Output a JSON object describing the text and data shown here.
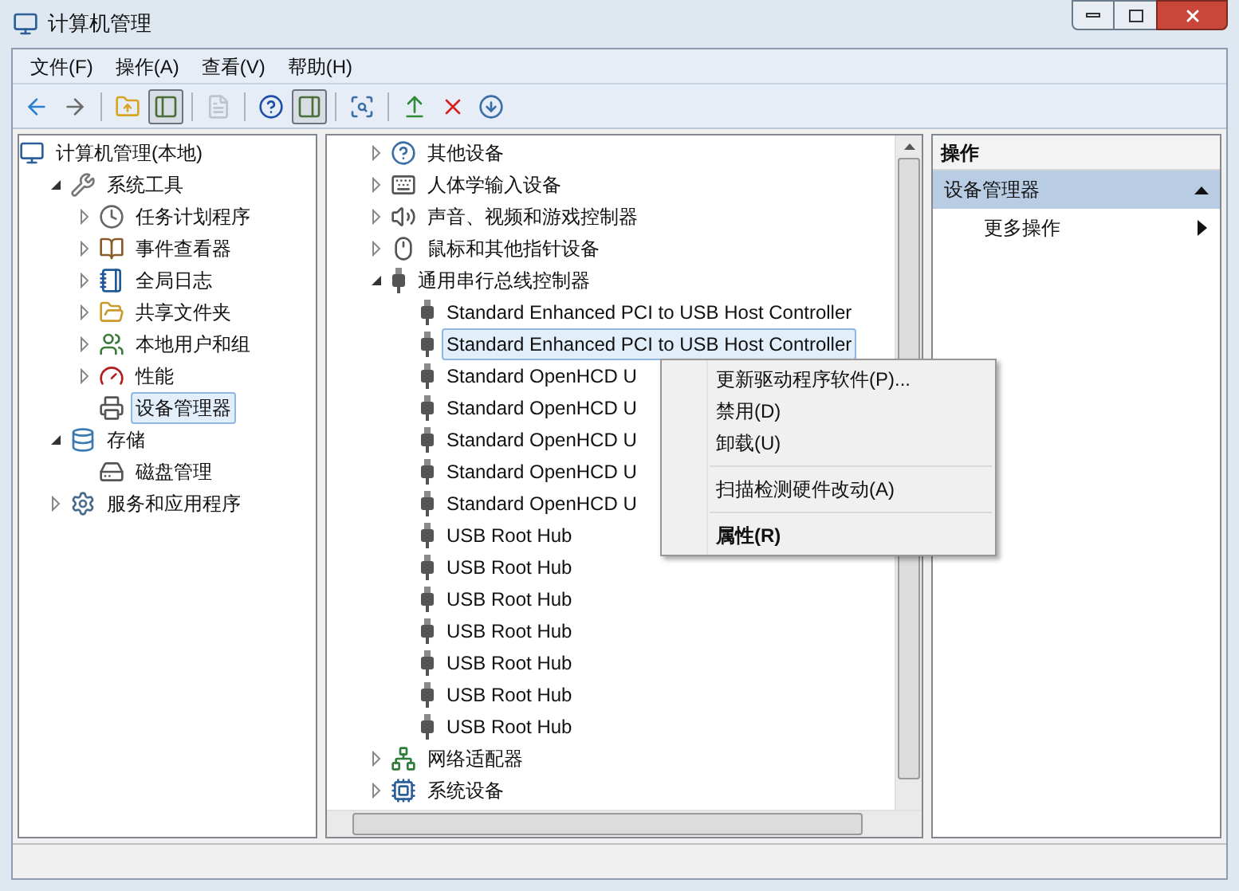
{
  "window": {
    "title": "计算机管理"
  },
  "menu_bar": [
    {
      "label": "文件(F)"
    },
    {
      "label": "操作(A)"
    },
    {
      "label": "查看(V)"
    },
    {
      "label": "帮助(H)"
    }
  ],
  "toolbar": [
    {
      "kind": "button",
      "pressed": false,
      "disabled": false
    },
    {
      "kind": "button",
      "pressed": false,
      "disabled": false
    },
    {
      "kind": "separator"
    },
    {
      "kind": "button",
      "pressed": false,
      "disabled": false
    },
    {
      "kind": "button",
      "pressed": true,
      "disabled": false
    },
    {
      "kind": "separator"
    },
    {
      "kind": "button",
      "pressed": false,
      "disabled": true
    },
    {
      "kind": "separator"
    },
    {
      "kind": "button",
      "pressed": false,
      "disabled": false
    },
    {
      "kind": "button",
      "pressed": true,
      "disabled": false
    },
    {
      "kind": "separator"
    },
    {
      "kind": "button",
      "pressed": false,
      "disabled": false
    },
    {
      "kind": "separator"
    },
    {
      "kind": "button",
      "pressed": false,
      "disabled": false
    },
    {
      "kind": "button",
      "pressed": false,
      "disabled": false
    },
    {
      "kind": "button",
      "pressed": false,
      "disabled": false
    }
  ],
  "console_tree": [
    {
      "kind": "root",
      "label": "计算机管理(本地)",
      "selected": false,
      "children": [
        {
          "kind": "branch",
          "label": "系统工具",
          "expanded": true,
          "selected": false,
          "children": [
            {
              "kind": "branch",
              "label": "任务计划程序",
              "expanded": false,
              "selected": false
            },
            {
              "kind": "branch",
              "label": "事件查看器",
              "expanded": false,
              "selected": false
            },
            {
              "kind": "branch",
              "label": "全局日志",
              "expanded": false,
              "selected": false
            },
            {
              "kind": "branch",
              "label": "共享文件夹",
              "expanded": false,
              "selected": false
            },
            {
              "kind": "branch",
              "label": "本地用户和组",
              "expanded": false,
              "selected": false
            },
            {
              "kind": "branch",
              "label": "性能",
              "expanded": false,
              "selected": false
            },
            {
              "kind": "leaf",
              "label": "设备管理器",
              "selected": true
            }
          ]
        },
        {
          "kind": "branch",
          "label": "存储",
          "expanded": true,
          "selected": false,
          "children": [
            {
              "kind": "leaf",
              "label": "磁盘管理",
              "selected": false
            }
          ]
        },
        {
          "kind": "branch",
          "label": "服务和应用程序",
          "expanded": false,
          "selected": false
        }
      ]
    }
  ],
  "device_tree": [
    {
      "kind": "branch",
      "label": "其他设备",
      "expanded": false,
      "selected": false
    },
    {
      "kind": "branch",
      "label": "人体学输入设备",
      "expanded": false,
      "selected": false
    },
    {
      "kind": "branch",
      "label": "声音、视频和游戏控制器",
      "expanded": false,
      "selected": false
    },
    {
      "kind": "branch",
      "label": "鼠标和其他指针设备",
      "expanded": false,
      "selected": false
    },
    {
      "kind": "branch",
      "label": "通用串行总线控制器",
      "expanded": true,
      "selected": false,
      "children": [
        {
          "kind": "leaf",
          "label": "Standard Enhanced PCI to USB Host Controller",
          "selected": false
        },
        {
          "kind": "leaf",
          "label": "Standard Enhanced PCI to USB Host Controller",
          "selected": true
        },
        {
          "kind": "leaf",
          "label": "Standard OpenHCD U",
          "selected": false
        },
        {
          "kind": "leaf",
          "label": "Standard OpenHCD U",
          "selected": false
        },
        {
          "kind": "leaf",
          "label": "Standard OpenHCD U",
          "selected": false
        },
        {
          "kind": "leaf",
          "label": "Standard OpenHCD U",
          "selected": false
        },
        {
          "kind": "leaf",
          "label": "Standard OpenHCD U",
          "selected": false
        },
        {
          "kind": "leaf",
          "label": "USB Root Hub",
          "selected": false
        },
        {
          "kind": "leaf",
          "label": "USB Root Hub",
          "selected": false
        },
        {
          "kind": "leaf",
          "label": "USB Root Hub",
          "selected": false
        },
        {
          "kind": "leaf",
          "label": "USB Root Hub",
          "selected": false
        },
        {
          "kind": "leaf",
          "label": "USB Root Hub",
          "selected": false
        },
        {
          "kind": "leaf",
          "label": "USB Root Hub",
          "selected": false
        },
        {
          "kind": "leaf",
          "label": "USB Root Hub",
          "selected": false
        }
      ]
    },
    {
      "kind": "branch",
      "label": "网络适配器",
      "expanded": false,
      "selected": false
    },
    {
      "kind": "branch",
      "label": "系统设备",
      "expanded": false,
      "selected": false
    }
  ],
  "context_menu": [
    {
      "kind": "item",
      "label": "更新驱动程序软件(P)...",
      "default": false
    },
    {
      "kind": "item",
      "label": "禁用(D)",
      "default": false
    },
    {
      "kind": "item",
      "label": "卸载(U)",
      "default": false
    },
    {
      "kind": "separator"
    },
    {
      "kind": "item",
      "label": "扫描检测硬件改动(A)",
      "default": false
    },
    {
      "kind": "separator"
    },
    {
      "kind": "item",
      "label": "属性(R)",
      "default": true
    }
  ],
  "actions_pane": {
    "title": "操作",
    "sections": [
      {
        "label": "设备管理器",
        "expanded": true,
        "items": [
          {
            "label": "更多操作"
          }
        ]
      }
    ]
  }
}
